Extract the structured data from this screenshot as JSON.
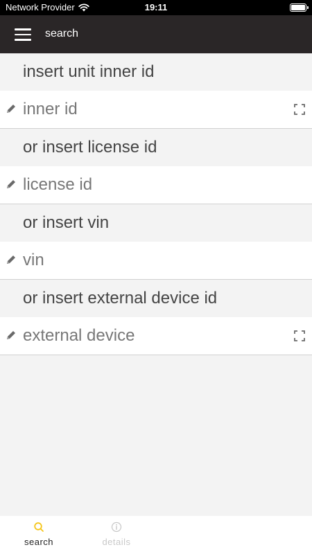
{
  "status_bar": {
    "carrier": "Network Provider",
    "time": "19:11"
  },
  "header": {
    "title": "search",
    "menu_icon": "hamburger-menu-icon"
  },
  "form": {
    "unit_inner_id_label": "insert unit inner id",
    "unit_inner_id_placeholder": "inner id",
    "license_label": "or insert license id",
    "license_placeholder": "license id",
    "vin_label": "or insert vin",
    "vin_placeholder": "vin",
    "external_device_label": "or insert external device id",
    "external_device_placeholder": "external device",
    "field_icon": "pencil-icon",
    "scan_icon": "scan-icon"
  },
  "tabs": {
    "search_label": "search",
    "details_label": "details",
    "active_color": "#f5c518",
    "inactive_color": "#c8c8c8"
  }
}
